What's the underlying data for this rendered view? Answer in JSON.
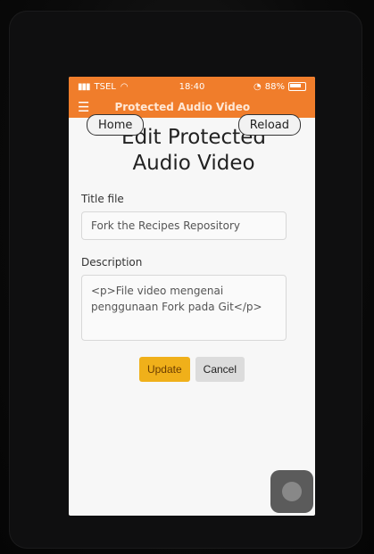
{
  "status": {
    "carrier": "TSEL",
    "time": "18:40",
    "battery": "88%"
  },
  "appbar": {
    "title": "Protected Audio Video"
  },
  "nav": {
    "home": "Home",
    "reload": "Reload"
  },
  "page": {
    "title": "Edit Protected Audio Video"
  },
  "form": {
    "title_label": "Title file",
    "title_value": "Fork the Recipes Repository",
    "description_label": "Description",
    "description_value": "<p>File video mengenai penggunaan Fork pada Git</p>"
  },
  "actions": {
    "update": "Update",
    "cancel": "Cancel"
  },
  "icons": {
    "menu": "hamburger-menu-icon",
    "assistive_touch": "assistive-touch-icon"
  },
  "colors": {
    "accent": "#f07d2b",
    "update_button": "#f0b01a",
    "cancel_button": "#dcdcdc"
  }
}
